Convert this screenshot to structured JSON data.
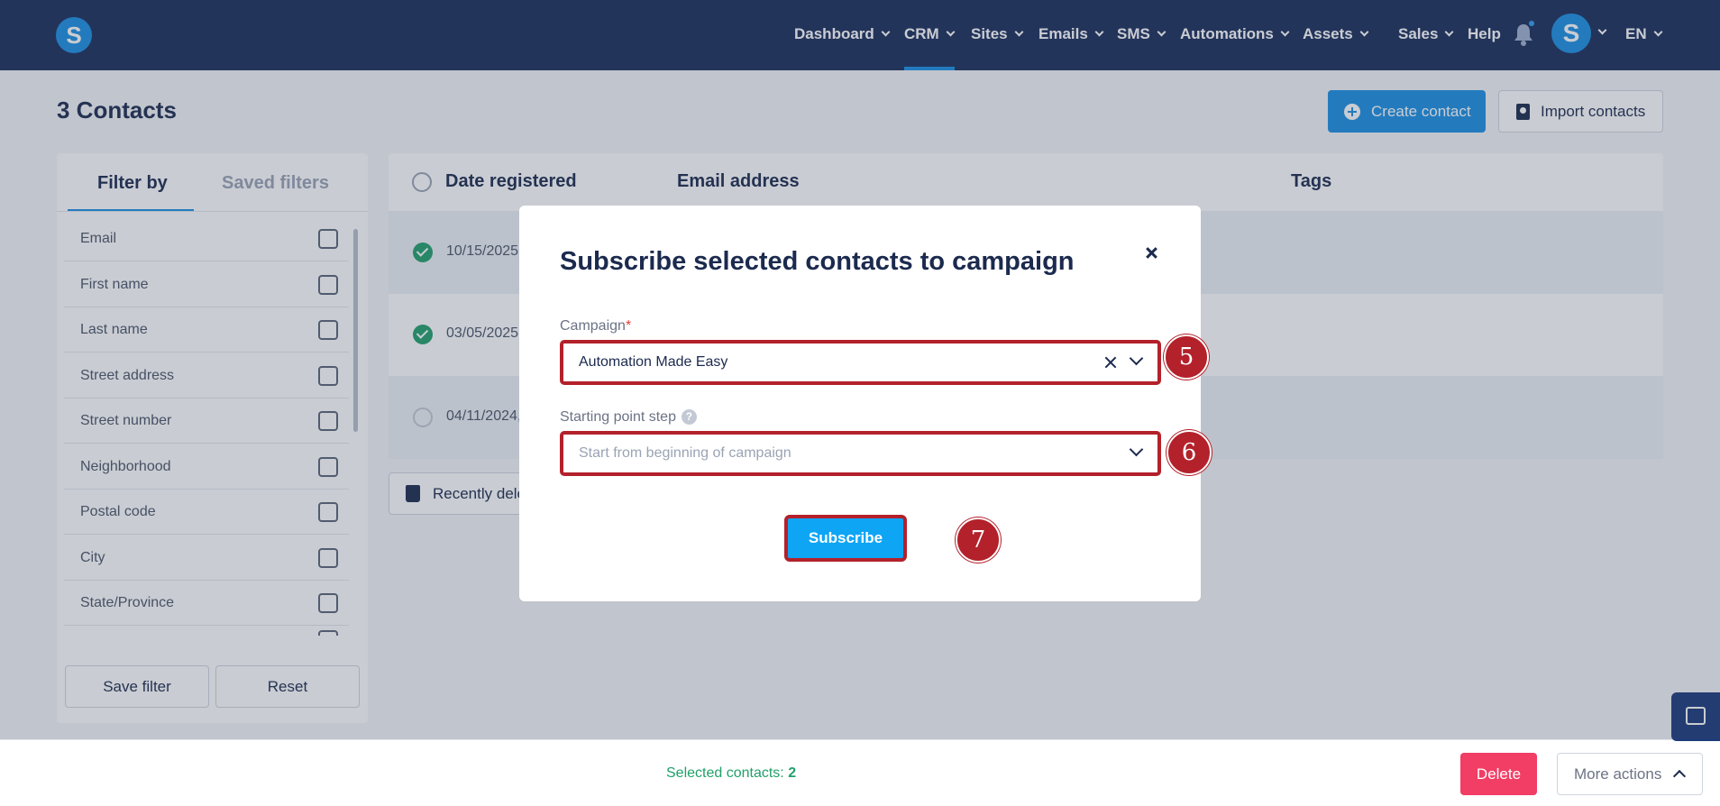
{
  "nav": {
    "logo": "S",
    "items": [
      {
        "label": "Dashboard"
      },
      {
        "label": "CRM"
      },
      {
        "label": "Sites"
      },
      {
        "label": "Emails"
      },
      {
        "label": "SMS"
      },
      {
        "label": "Automations"
      },
      {
        "label": "Assets"
      },
      {
        "label": "Sales"
      }
    ],
    "help": "Help",
    "avatar": "S",
    "language": "EN"
  },
  "page": {
    "title": "3 Contacts",
    "create_button": "Create contact",
    "import_button": "Import contacts"
  },
  "filters": {
    "tab_active": "Filter by",
    "tab_inactive": "Saved filters",
    "items": [
      "Email",
      "First name",
      "Last name",
      "Street address",
      "Street number",
      "Neighborhood",
      "Postal code",
      "City",
      "State/Province"
    ],
    "save_button": "Save filter",
    "reset_button": "Reset"
  },
  "table": {
    "headers": {
      "date": "Date registered",
      "email": "Email address",
      "tags": "Tags"
    },
    "rows": [
      {
        "date": "10/15/2025,",
        "selected": true
      },
      {
        "date": "03/05/2025",
        "selected": true
      },
      {
        "date": "04/11/2024,",
        "selected": false
      }
    ],
    "recently_deleted": "Recently dele"
  },
  "bottom": {
    "selected_label": "Selected contacts:",
    "selected_count": "2",
    "delete_button": "Delete",
    "more_actions": "More actions"
  },
  "modal": {
    "title": "Subscribe selected contacts to campaign",
    "campaign_label": "Campaign",
    "required_mark": "*",
    "campaign_value": "Automation Made Easy",
    "start_label": "Starting point step",
    "help_mark": "?",
    "start_placeholder": "Start from beginning of campaign",
    "subscribe_button": "Subscribe"
  },
  "steps": [
    "5",
    "6",
    "7"
  ],
  "colors": {
    "nav_bg": "#1a2d5a",
    "primary": "#1a8fe3",
    "highlight": "#b3212b",
    "success": "#21a06a",
    "danger": "#f23d64"
  }
}
